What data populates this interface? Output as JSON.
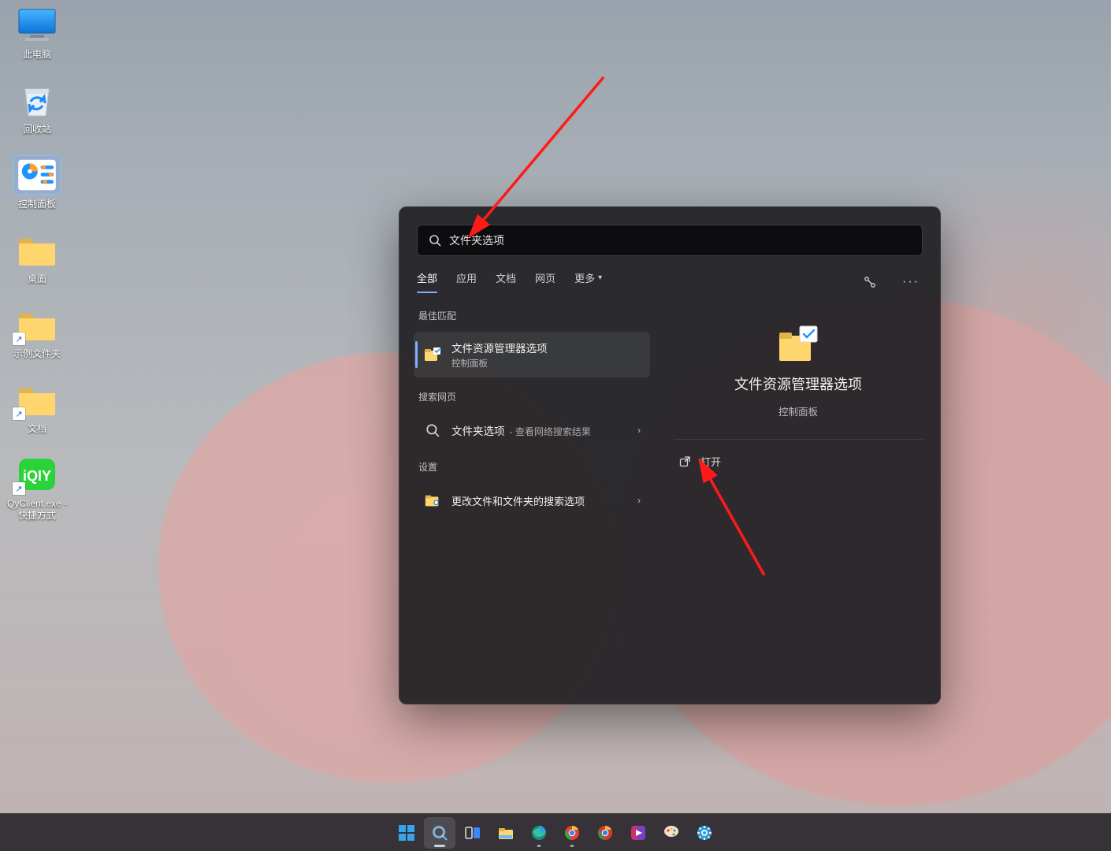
{
  "desktop": {
    "icons": [
      {
        "key": "this-pc",
        "label": "此电脑"
      },
      {
        "key": "recycle-bin",
        "label": "回收站"
      },
      {
        "key": "control-panel",
        "label": "控制面板"
      },
      {
        "key": "desktop-folder",
        "label": "桌面"
      },
      {
        "key": "demo-folder",
        "label": "示例文件夹"
      },
      {
        "key": "docs-folder",
        "label": "文档"
      },
      {
        "key": "qy-client",
        "label": "QyClient.exe - 快捷方式"
      }
    ]
  },
  "search": {
    "query": "文件夹选项",
    "tabs": {
      "all": "全部",
      "apps": "应用",
      "docs": "文档",
      "web": "网页",
      "more": "更多"
    },
    "sections": {
      "best": "最佳匹配",
      "web": "搜索网页",
      "settings": "设置"
    },
    "best_match": {
      "title": "文件资源管理器选项",
      "subtitle": "控制面板"
    },
    "web_result": {
      "prefix": "文件夹选项",
      "suffix": "查看网络搜索结果"
    },
    "settings_result": "更改文件和文件夹的搜索选项",
    "preview": {
      "title": "文件资源管理器选项",
      "subtitle": "控制面板",
      "open_label": "打开"
    }
  },
  "taskbar": {
    "items": [
      "start",
      "search",
      "task-view",
      "explorer",
      "edge",
      "chrome",
      "chrome-canary",
      "clipchamp",
      "paint",
      "settings"
    ]
  }
}
